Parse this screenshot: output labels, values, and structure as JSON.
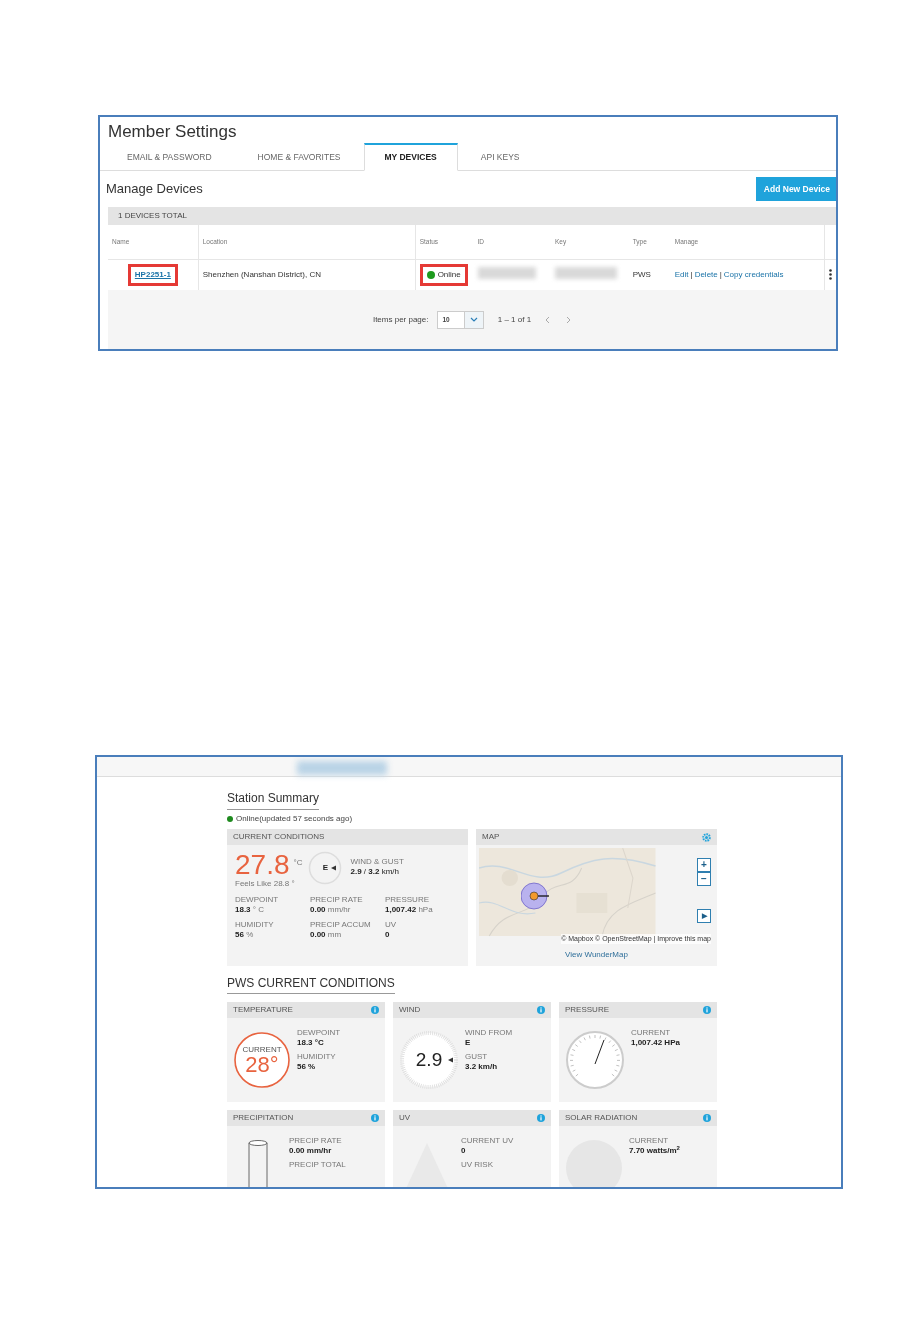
{
  "settings_screenshot": {
    "title": "Member Settings",
    "tabs": [
      {
        "label": "EMAIL & PASSWORD",
        "selected": false
      },
      {
        "label": "HOME & FAVORITES",
        "selected": false
      },
      {
        "label": "MY DEVICES",
        "selected": true
      },
      {
        "label": "API KEYS",
        "selected": false
      }
    ],
    "heading": "Manage Devices",
    "add_button": "Add New Device",
    "total_label": "1 DEVICES TOTAL",
    "columns": [
      "Name",
      "Location",
      "Status",
      "ID",
      "Key",
      "Type",
      "Manage"
    ],
    "rows": [
      {
        "name": "HP2251-1",
        "name_highlighted": true,
        "location": "Shenzhen (Nanshan District), CN",
        "status": "Online",
        "online": true,
        "status_highlighted": true,
        "type": "PWS",
        "separator": "|",
        "actions": [
          "Edit",
          "Delete",
          "Copy credentials"
        ]
      }
    ],
    "pagination": {
      "label": "Items per page:",
      "per_page": "10",
      "range": "1 – 1 of 1"
    }
  },
  "station_screenshot": {
    "summary_title": "Station Summary",
    "status": "Online(updated 57 seconds ago)",
    "online": true,
    "current_conditions": {
      "title": "CURRENT CONDITIONS",
      "temperature": "27.8",
      "temp_unit": "°C",
      "feels_like": "Feels Like 28.8 °",
      "compass": "E",
      "wind_label": "WIND & GUST",
      "wind_value": "**2.9** / **3.2** km/h",
      "metrics": [
        {
          "label": "DEWPOINT",
          "value": "18.3",
          "unit": "° C"
        },
        {
          "label": "PRECIP RATE",
          "value": "0.00",
          "unit": "mm/hr"
        },
        {
          "label": "PRESSURE",
          "value": "1,007.42",
          "unit": "hPa"
        },
        {
          "label": "HUMIDITY",
          "value": "56",
          "unit": "%"
        },
        {
          "label": "PRECIP ACCUM",
          "value": "0.00",
          "unit": "mm"
        },
        {
          "label": "UV",
          "value": "0"
        }
      ]
    },
    "map": {
      "title": "MAP",
      "zoom_in": "+",
      "zoom_out": "−",
      "play": "▶",
      "attribution": "© Mapbox © OpenStreetMap | Improve this map",
      "link": "View WunderMap"
    },
    "section_title": "PWS CURRENT CONDITIONS",
    "cards": [
      {
        "kind": "temperature",
        "title": "TEMPERATURE",
        "gauge_label": "CURRENT",
        "gauge_value": "28°",
        "stats": [
          {
            "label": "DEWPOINT",
            "value": "18.3 °C"
          },
          {
            "label": "HUMIDITY",
            "value": "56 %"
          }
        ]
      },
      {
        "kind": "wind",
        "title": "WIND",
        "gauge_value": "2.9",
        "stats": [
          {
            "label": "WIND FROM",
            "value": "E"
          },
          {
            "label": "GUST",
            "value": "3.2 km/h"
          }
        ]
      },
      {
        "kind": "pressure",
        "title": "PRESSURE",
        "stats": [
          {
            "label": "CURRENT",
            "value": "1,007.42 HPa"
          }
        ]
      },
      {
        "kind": "precipitation",
        "title": "PRECIPITATION",
        "stats": [
          {
            "label": "PRECIP RATE",
            "value": "0.00 mm/hr"
          },
          {
            "label": "PRECIP TOTAL"
          }
        ]
      },
      {
        "kind": "uv",
        "title": "UV",
        "stats": [
          {
            "label": "CURRENT UV",
            "value": "0"
          },
          {
            "label": "UV RISK"
          }
        ]
      },
      {
        "kind": "solar",
        "title": "SOLAR RADIATION",
        "stats": [
          {
            "label": "CURRENT",
            "value": "7.70 watts/m$^{2}$"
          }
        ]
      }
    ]
  }
}
